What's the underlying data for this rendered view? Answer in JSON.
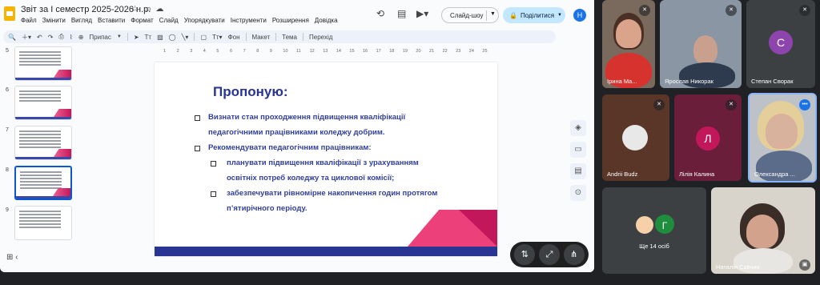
{
  "app": {
    "doc_title": "Звіт за І семестр 2025-2026 н.р.",
    "menu": [
      "Файл",
      "Змінити",
      "Вигляд",
      "Вставити",
      "Формат",
      "Слайд",
      "Упорядкувати",
      "Інструменти",
      "Розширення",
      "Довідка"
    ],
    "slideshow_label": "Слайд-шоу",
    "share_label": "Поділитися",
    "user_initial": "Н",
    "toolbar": {
      "assign_label": "Припас",
      "background_label": "Фон",
      "layout_label": "Макет",
      "theme_label": "Тема",
      "transition_label": "Перехід"
    }
  },
  "ruler_ticks": [
    "1",
    "2",
    "3",
    "4",
    "5",
    "6",
    "7",
    "8",
    "9",
    "10",
    "11",
    "12",
    "13",
    "14",
    "15",
    "16",
    "17",
    "18",
    "19",
    "20",
    "21",
    "22",
    "23",
    "24",
    "25"
  ],
  "slides": [
    {
      "num": "5",
      "selected": false
    },
    {
      "num": "6",
      "selected": false
    },
    {
      "num": "7",
      "selected": false
    },
    {
      "num": "8",
      "selected": true
    },
    {
      "num": "9",
      "selected": false
    }
  ],
  "slide": {
    "title": "Пропоную:",
    "b1_l1": "Визнати стан проходження підвищення кваліфікації",
    "b1_l2": "педагогічними працівниками коледжу добрим.",
    "b2": "Рекомендувати педагогічним працівникам:",
    "s1_l1": "планувати підвищення кваліфікації з урахуванням",
    "s1_l2": "освітніх потреб коледжу та циклової комісії;",
    "s2_l1": "забезпечувати рівномірне накопичення годин протягом",
    "s2_l2": "п’ятирічного періоду."
  },
  "participants": [
    {
      "name": "Ірина Ма...",
      "muted": true
    },
    {
      "name": "Ярослав Никорак",
      "muted": true
    },
    {
      "name": "Степан Сворак",
      "initial": "С",
      "color": "#8e44ad",
      "muted": true
    },
    {
      "name": "Andrii Budz",
      "muted": true
    },
    {
      "name": "Лілія Калина",
      "initial": "Л",
      "color": "#c2185b",
      "muted": true
    },
    {
      "name": "Олександра ...",
      "muted": false
    },
    {
      "name": "Ще 14 осіб",
      "initial": "Г",
      "color": "#1e8e3e"
    },
    {
      "name": "Наталія Савчин",
      "muted": false
    }
  ],
  "colors": {
    "accent_blue": "#283593",
    "pink": "#ec407a",
    "magenta": "#c2185b",
    "share_bg": "#c2e7ff"
  }
}
